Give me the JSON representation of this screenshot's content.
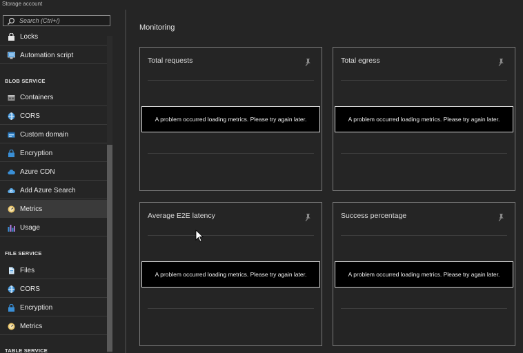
{
  "app": {
    "title": "Storage account"
  },
  "search": {
    "placeholder": "Search (Ctrl+/)"
  },
  "sidebar": {
    "top_items": [
      {
        "label": "Locks",
        "icon": "lock-icon"
      },
      {
        "label": "Automation script",
        "icon": "automation-script-icon"
      }
    ],
    "blob_section": "BLOB SERVICE",
    "blob_items": [
      {
        "label": "Containers",
        "icon": "containers-icon"
      },
      {
        "label": "CORS",
        "icon": "cors-icon"
      },
      {
        "label": "Custom domain",
        "icon": "custom-domain-icon"
      },
      {
        "label": "Encryption",
        "icon": "lock-icon"
      },
      {
        "label": "Azure CDN",
        "icon": "cloud-icon"
      },
      {
        "label": "Add Azure Search",
        "icon": "cloud-search-icon"
      },
      {
        "label": "Metrics",
        "icon": "metrics-gauge-icon",
        "active": true
      },
      {
        "label": "Usage",
        "icon": "usage-bars-icon"
      }
    ],
    "file_section": "FILE SERVICE",
    "file_items": [
      {
        "label": "Files",
        "icon": "file-icon"
      },
      {
        "label": "CORS",
        "icon": "cors-icon"
      },
      {
        "label": "Encryption",
        "icon": "lock-icon"
      },
      {
        "label": "Metrics",
        "icon": "metrics-gauge-icon"
      }
    ],
    "table_section": "TABLE SERVICE"
  },
  "main": {
    "title": "Monitoring",
    "tiles": [
      {
        "title": "Total requests",
        "error": "A problem occurred loading metrics. Please try again later."
      },
      {
        "title": "Total egress",
        "error": "A problem occurred loading metrics. Please try again later."
      },
      {
        "title": "Average E2E latency",
        "error": "A problem occurred loading metrics. Please try again later."
      },
      {
        "title": "Success percentage",
        "error": "A problem occurred loading metrics. Please try again later."
      }
    ]
  },
  "colors": {
    "background": "#252525",
    "active_item": "#3a3a3a",
    "accent_blue": "#3a8fd6"
  }
}
